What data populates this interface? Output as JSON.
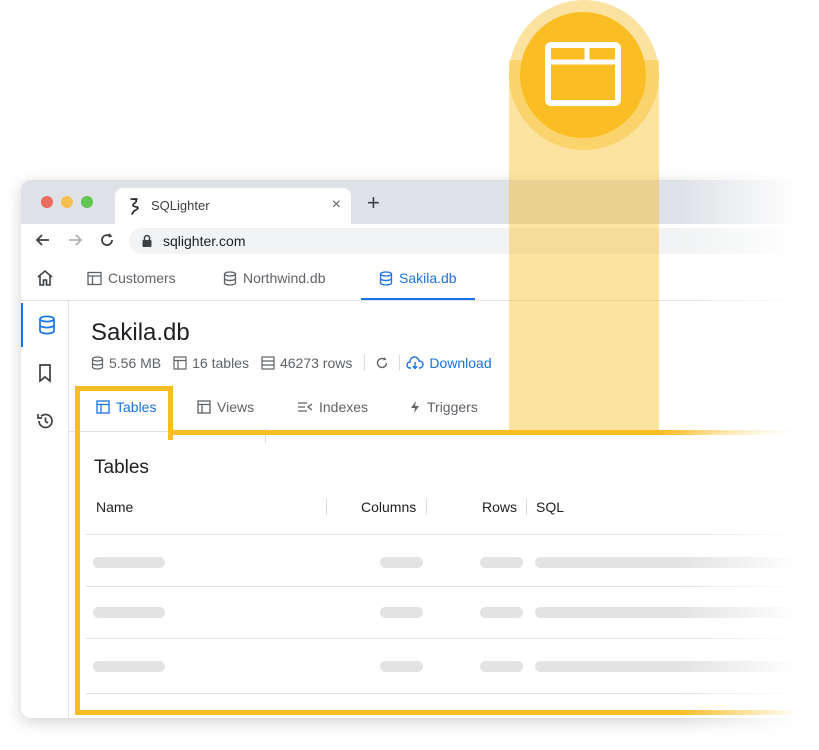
{
  "browser": {
    "tab_title": "SQLighter",
    "tab_close": "×",
    "new_tab": "+",
    "url": "sqlighter.com"
  },
  "db_tabs": [
    {
      "label": "Customers",
      "icon": "table-icon"
    },
    {
      "label": "Northwind.db",
      "icon": "database-icon"
    },
    {
      "label": "Sakila.db",
      "icon": "database-icon",
      "active": true
    }
  ],
  "sidebar": {
    "items": [
      {
        "name": "databases",
        "icon": "database-icon",
        "active": true
      },
      {
        "name": "saved",
        "icon": "bookmark-icon"
      },
      {
        "name": "history",
        "icon": "history-icon"
      }
    ]
  },
  "database": {
    "title": "Sakila.db",
    "size": "5.56 MB",
    "tables_count": "16 tables",
    "rows_count": "46273 rows",
    "download_label": "Download"
  },
  "subtabs": [
    {
      "label": "Tables",
      "icon": "table-icon",
      "active": true
    },
    {
      "label": "Views",
      "icon": "view-icon"
    },
    {
      "label": "Indexes",
      "icon": "index-icon"
    },
    {
      "label": "Triggers",
      "icon": "bolt-icon"
    }
  ],
  "tables_section": {
    "title": "Tables",
    "columns": [
      "Name",
      "Columns",
      "Rows",
      "SQL"
    ],
    "loading_rows": 3
  },
  "colors": {
    "accent": "#1a73e8",
    "highlight": "#fbbd24"
  }
}
